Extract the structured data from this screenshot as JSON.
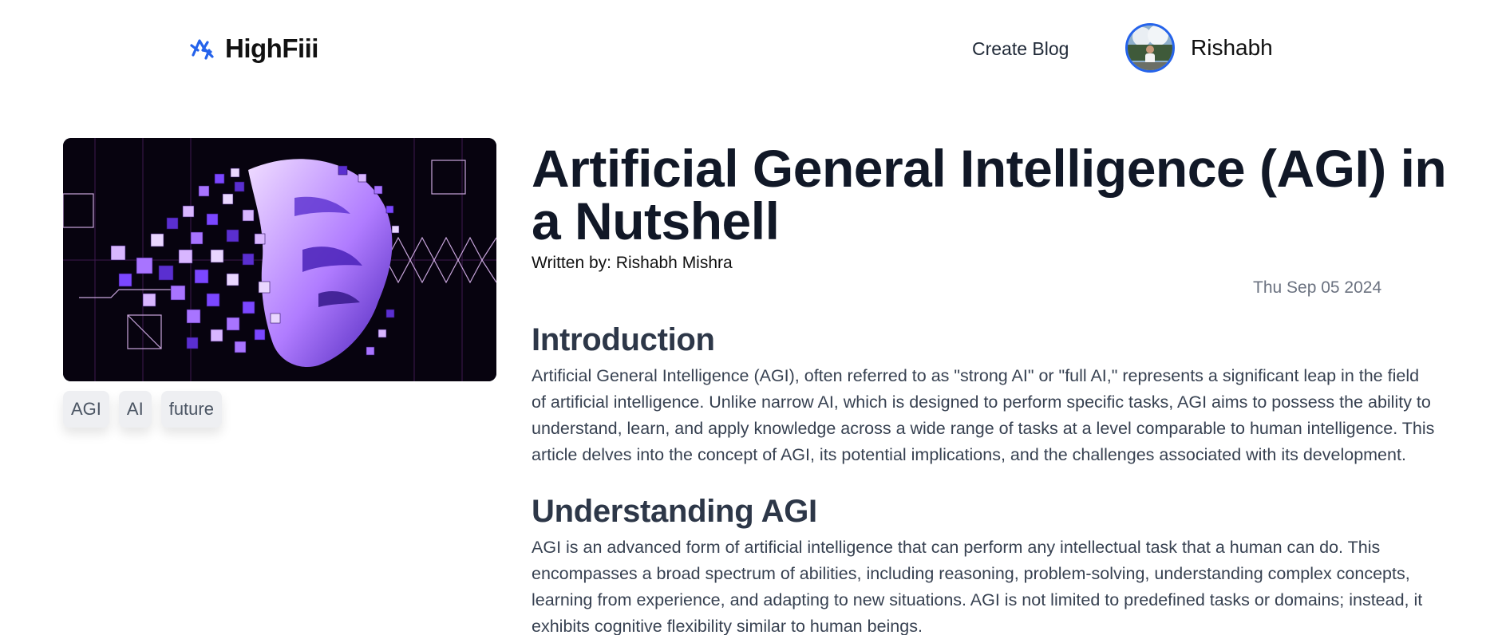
{
  "header": {
    "brand": "HighFiii",
    "create_blog": "Create Blog",
    "user_name": "Rishabh"
  },
  "colors": {
    "accent": "#2563eb",
    "title": "#111827",
    "body_text": "#374151",
    "muted": "#6b7280",
    "tag_bg": "#eeeff2"
  },
  "icons": {
    "brand": "highfiii-logo-icon",
    "avatar": "user-avatar"
  },
  "post": {
    "image_alt": "pixelated violet voxel face",
    "tags": [
      "AGI",
      "AI",
      "future"
    ],
    "title": "Artificial General Intelligence (AGI) in a Nutshell",
    "author_line": "Written by: Rishabh Mishra",
    "date": "Thu Sep 05 2024",
    "sections": [
      {
        "heading": "Introduction",
        "body": "Artificial General Intelligence (AGI), often referred to as \"strong AI\" or \"full AI,\" represents a significant leap in the field of artificial intelligence. Unlike narrow AI, which is designed to perform specific tasks, AGI aims to possess the ability to understand, learn, and apply knowledge across a wide range of tasks at a level comparable to human intelligence. This article delves into the concept of AGI, its potential implications, and the challenges associated with its development."
      },
      {
        "heading": "Understanding AGI",
        "body": "AGI is an advanced form of artificial intelligence that can perform any intellectual task that a human can do. This encompasses a broad spectrum of abilities, including reasoning, problem-solving, understanding complex concepts, learning from experience, and adapting to new situations. AGI is not limited to predefined tasks or domains; instead, it exhibits cognitive flexibility similar to human beings."
      }
    ]
  }
}
